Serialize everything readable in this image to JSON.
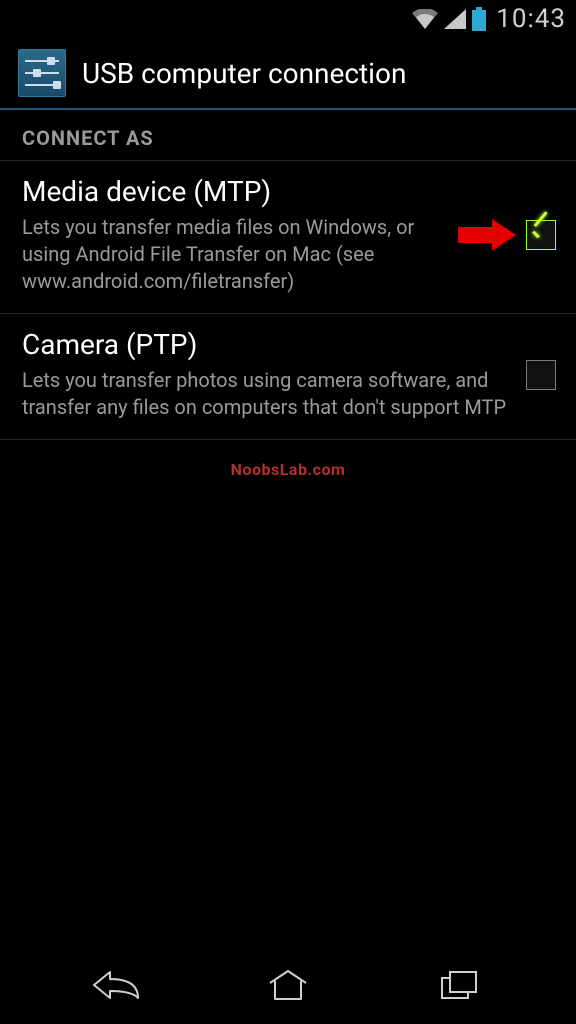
{
  "status": {
    "time": "10:43"
  },
  "header": {
    "title": "USB computer connection"
  },
  "section": {
    "label": "CONNECT AS"
  },
  "options": [
    {
      "title": "Media device (MTP)",
      "desc": "Lets you transfer media files on Windows, or using Android File Transfer on Mac (see www.android.com/filetransfer)",
      "checked": true,
      "has_arrow": true
    },
    {
      "title": "Camera (PTP)",
      "desc": "Lets you transfer photos using camera software, and transfer any files on computers that don't support MTP",
      "checked": false,
      "has_arrow": false
    }
  ],
  "watermark": "NoobsLab.com"
}
